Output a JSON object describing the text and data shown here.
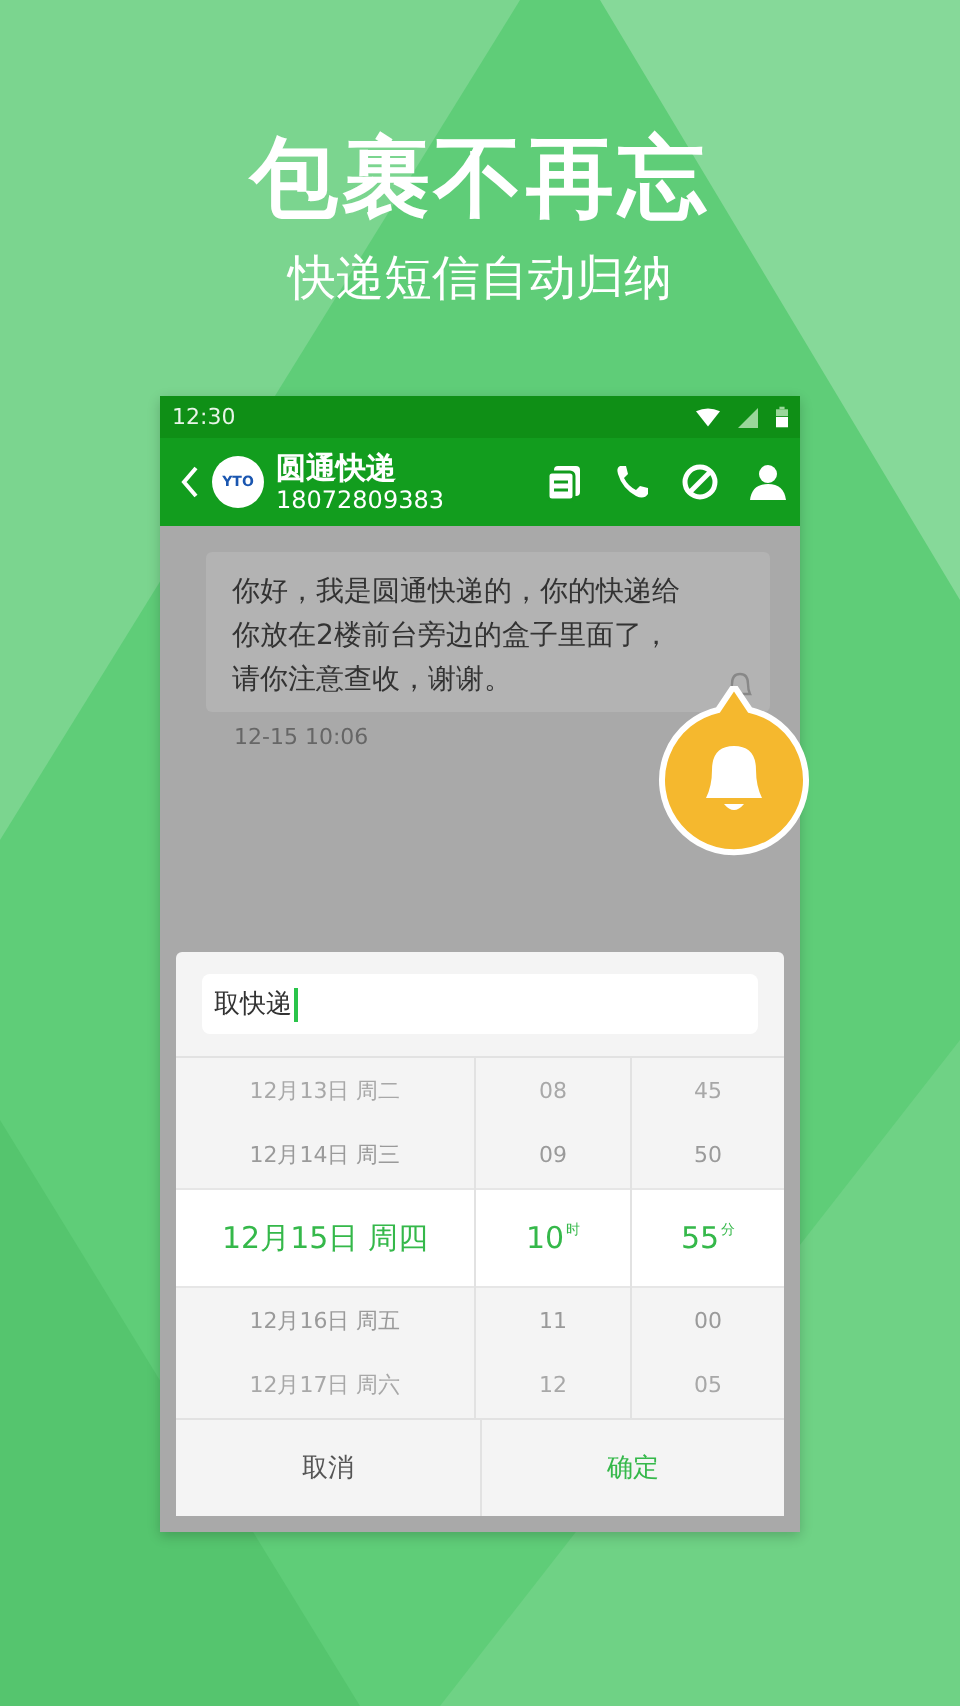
{
  "headline": "包裹不再忘",
  "subtitle": "快递短信自动归纳",
  "status_bar": {
    "time": "12:30"
  },
  "contact": {
    "name": "圆通快递",
    "number": "18072809383",
    "avatar_text": "YTO"
  },
  "message": {
    "text": "你好，我是圆通快递的，你的快递给你放在2楼前台旁边的盒子里面了，请你注意查收，谢谢。",
    "time": "12-15 10:06"
  },
  "dialog": {
    "input_value": "取快递",
    "picker": [
      {
        "items": [
          {
            "label": "12月13日 周二",
            "selected": false
          },
          {
            "label": "12月14日 周三",
            "selected": false
          },
          {
            "label": "12月15日 周四",
            "selected": true
          },
          {
            "label": "12月16日 周五",
            "selected": false
          },
          {
            "label": "12月17日 周六",
            "selected": false
          }
        ]
      },
      {
        "unit": "时",
        "items": [
          {
            "label": "08",
            "selected": false
          },
          {
            "label": "09",
            "selected": false
          },
          {
            "label": "10",
            "selected": true
          },
          {
            "label": "11",
            "selected": false
          },
          {
            "label": "12",
            "selected": false
          }
        ]
      },
      {
        "unit": "分",
        "items": [
          {
            "label": "45",
            "selected": false
          },
          {
            "label": "50",
            "selected": false
          },
          {
            "label": "55",
            "selected": true
          },
          {
            "label": "00",
            "selected": false
          },
          {
            "label": "05",
            "selected": false
          }
        ]
      }
    ],
    "buttons": [
      {
        "label": "取消",
        "kind": "cancel"
      },
      {
        "label": "确定",
        "kind": "confirm"
      }
    ]
  }
}
